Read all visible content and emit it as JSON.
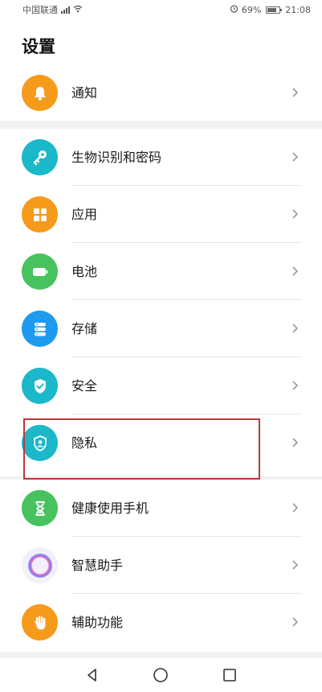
{
  "status_bar": {
    "carrier": "中国联通",
    "battery": "69%",
    "time": "21:08"
  },
  "header": {
    "title": "设置"
  },
  "groups": [
    {
      "items": [
        {
          "label": "通知",
          "icon": "bell-icon",
          "color": "#f59a1b"
        }
      ]
    },
    {
      "items": [
        {
          "label": "生物识别和密码",
          "icon": "key-icon",
          "color": "#1ab8c9"
        },
        {
          "label": "应用",
          "icon": "apps-grid-icon",
          "color": "#f59a1b"
        },
        {
          "label": "电池",
          "icon": "battery-icon",
          "color": "#47c25f"
        },
        {
          "label": "存储",
          "icon": "storage-icon",
          "color": "#1e9bef"
        },
        {
          "label": "安全",
          "icon": "shield-check-icon",
          "color": "#1ab8c9"
        },
        {
          "label": "隐私",
          "icon": "privacy-shield-icon",
          "color": "#1ab8c9"
        }
      ]
    },
    {
      "items": [
        {
          "label": "健康使用手机",
          "icon": "hourglass-icon",
          "color": "#47c25f"
        },
        {
          "label": "智慧助手",
          "icon": "assistant-ring-icon",
          "color": "#a873e8"
        },
        {
          "label": "辅助功能",
          "icon": "hand-icon",
          "color": "#f59a1b"
        }
      ]
    }
  ],
  "nav_bar": {
    "back_icon": "back-triangle-icon",
    "home_icon": "home-circle-icon",
    "recents_icon": "recents-square-icon"
  }
}
